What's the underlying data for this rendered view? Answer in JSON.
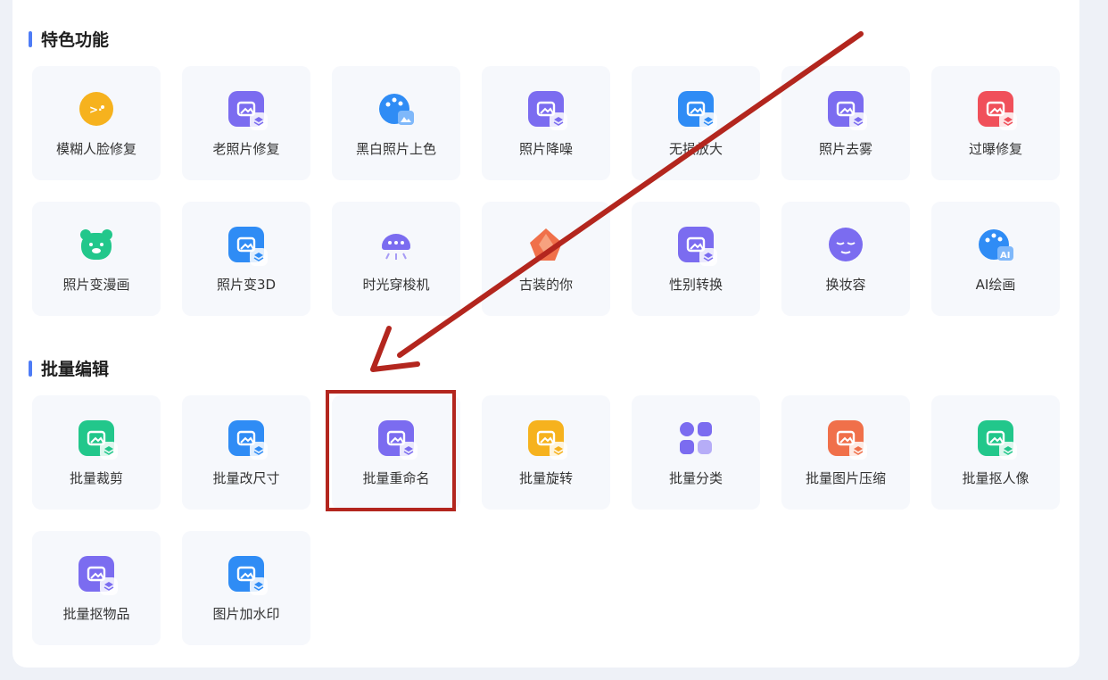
{
  "sections": [
    {
      "title": "特色功能",
      "tiles": [
        {
          "label": "模糊人脸修复",
          "icon": "face-blur-icon",
          "color": "#f6b21e"
        },
        {
          "label": "老照片修复",
          "icon": "old-photo-icon",
          "color": "#7b6cf0"
        },
        {
          "label": "黑白照片上色",
          "icon": "palette-icon",
          "color": "#2f8cf5"
        },
        {
          "label": "照片降噪",
          "icon": "denoise-icon",
          "color": "#7b6cf0"
        },
        {
          "label": "无损放大",
          "icon": "enlarge-icon",
          "color": "#2f8cf5"
        },
        {
          "label": "照片去雾",
          "icon": "defog-icon",
          "color": "#7b6cf0"
        },
        {
          "label": "过曝修复",
          "icon": "overexposure-icon",
          "color": "#f0505a"
        },
        {
          "label": "照片变漫画",
          "icon": "cartoon-bear-icon",
          "color": "#22c78b"
        },
        {
          "label": "照片变3D",
          "icon": "cube-3d-icon",
          "color": "#2f8cf5"
        },
        {
          "label": "时光穿梭机",
          "icon": "time-machine-icon",
          "color": "#7b6cf0"
        },
        {
          "label": "古装的你",
          "icon": "ancient-costume-icon",
          "color": "#f0704a"
        },
        {
          "label": "性别转换",
          "icon": "gender-swap-icon",
          "color": "#7b6cf0"
        },
        {
          "label": "换妆容",
          "icon": "makeup-face-icon",
          "color": "#7b6cf0"
        },
        {
          "label": "AI绘画",
          "icon": "ai-paint-icon",
          "color": "#2f8cf5"
        }
      ]
    },
    {
      "title": "批量编辑",
      "tiles": [
        {
          "label": "批量裁剪",
          "icon": "batch-crop-icon",
          "color": "#22c78b"
        },
        {
          "label": "批量改尺寸",
          "icon": "batch-resize-icon",
          "color": "#2f8cf5"
        },
        {
          "label": "批量重命名",
          "icon": "batch-rename-icon",
          "color": "#7b6cf0"
        },
        {
          "label": "批量旋转",
          "icon": "batch-rotate-icon",
          "color": "#f6b21e"
        },
        {
          "label": "批量分类",
          "icon": "batch-classify-icon",
          "color": "#7b6cf0"
        },
        {
          "label": "批量图片压缩",
          "icon": "batch-compress-icon",
          "color": "#f0704a"
        },
        {
          "label": "批量抠人像",
          "icon": "batch-cutout-portrait-icon",
          "color": "#22c78b"
        },
        {
          "label": "批量抠物品",
          "icon": "batch-cutout-object-icon",
          "color": "#7b6cf0"
        },
        {
          "label": "图片加水印",
          "icon": "watermark-icon",
          "color": "#2f8cf5"
        }
      ]
    }
  ],
  "highlight": {
    "target": "批量重命名",
    "color": "#b3261e"
  },
  "arrow_color": "#b3261e"
}
